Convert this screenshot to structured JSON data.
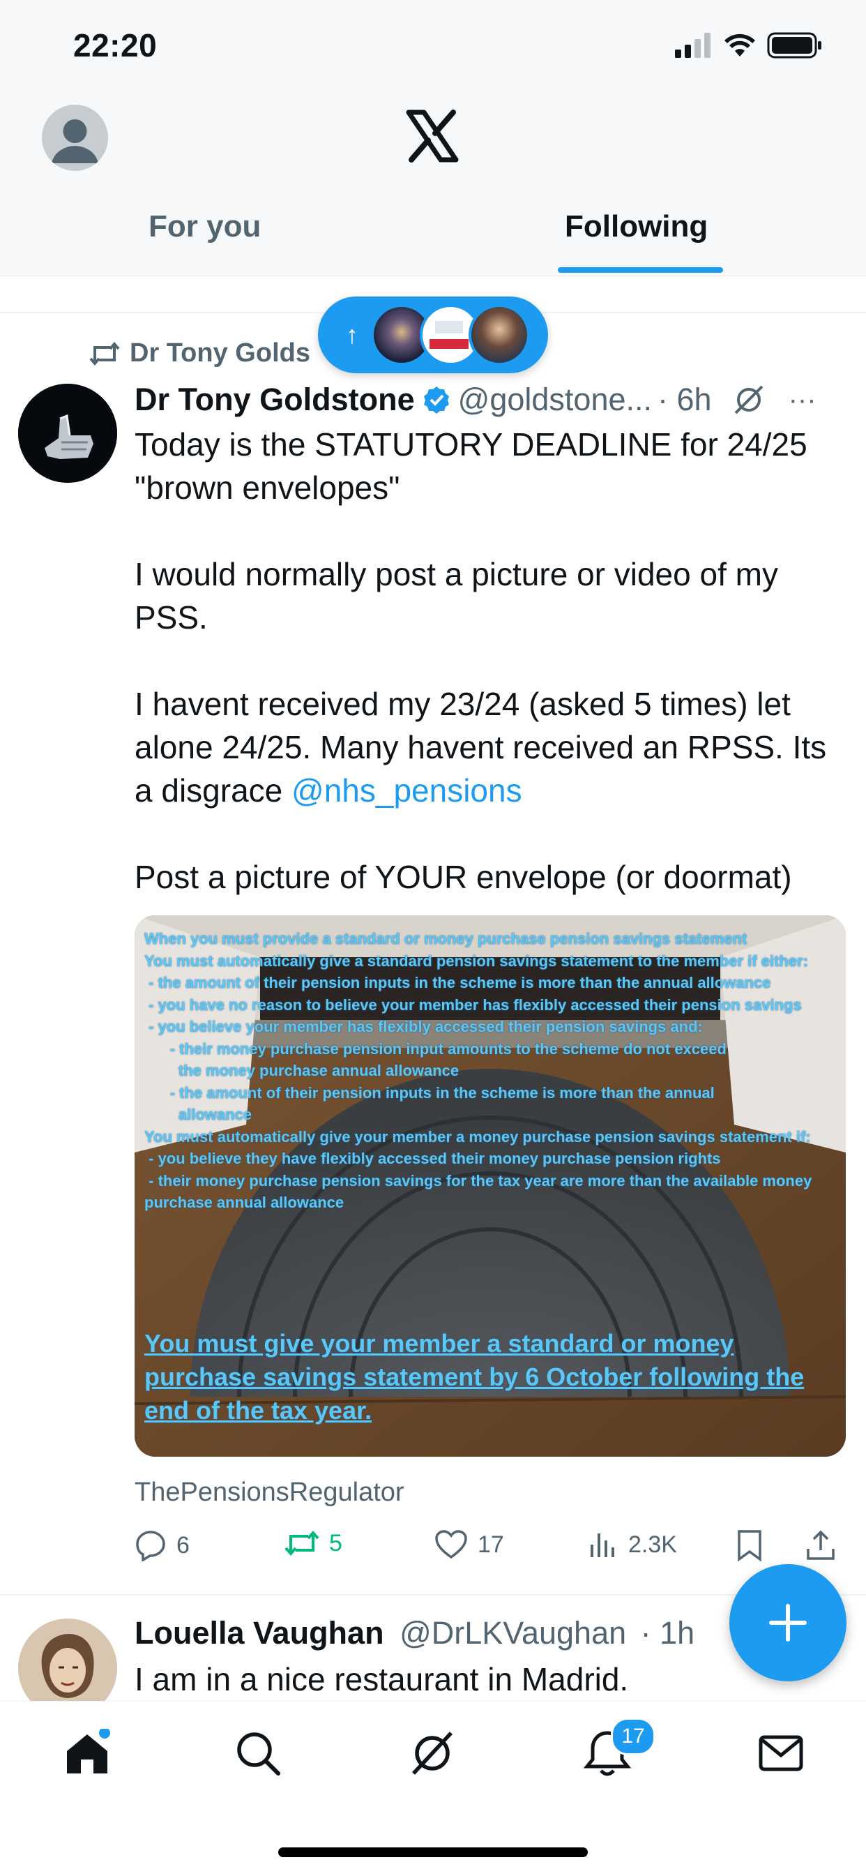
{
  "status_bar": {
    "time": "22:20"
  },
  "header": {
    "tabs": [
      {
        "label": "For you"
      },
      {
        "label": "Following"
      }
    ],
    "new_posts_arrow": "↑"
  },
  "timeline": {
    "repost": {
      "label": "Dr Tony Golds"
    },
    "tweets": [
      {
        "name": "Dr Tony Goldstone",
        "handle": "@goldstone...",
        "time": "· 6h",
        "more": "···",
        "body_intro": "Today is the STATUTORY DEADLINE for 24/25 \"brown envelopes\"\n\nI would normally post a picture or video of my PSS.\n\nI havent received my 23/24 (asked 5 times) let alone 24/25. Many havent received an RPSS. Its a disgrace ",
        "mention": "@nhs_pensions",
        "body_outro": "\n\nPost a picture of YOUR envelope (or doormat)",
        "media_text": "When you must provide a standard or money purchase pension savings statement\nYou must automatically give a standard pension savings statement to the member if either:\n - the amount of their pension inputs in the scheme is more than the annual allowance\n - you have no reason to believe your member has flexibly accessed their pension savings\n - you believe your member has flexibly accessed their pension savings and:\n      - their money purchase pension input amounts to the scheme do not exceed\n        the money purchase annual allowance\n      - the amount of their pension inputs in the scheme is more than the annual\n        allowance\nYou must automatically give your member a money purchase pension savings statement if:\n - you believe they have flexibly accessed their money purchase pension rights\n - their money purchase pension savings for the tax year are more than the available money purchase annual allowance",
        "media_big_text": "You must give your member a standard or money purchase savings statement by 6 October following the end of the tax year.",
        "source": "ThePensionsRegulator",
        "replies": "6",
        "reposts": "5",
        "likes": "17",
        "views": "2.3K"
      },
      {
        "name": "Louella Vaughan",
        "handle": "@DrLKVaughan",
        "time": "· 1h",
        "body": "I am in a nice restaurant in Madrid."
      }
    ]
  },
  "bottom_nav": {
    "notifications_badge": "17"
  },
  "colors": {
    "accent": "#1d9bf0",
    "repost_green": "#00ba7c",
    "muted": "#536471"
  }
}
